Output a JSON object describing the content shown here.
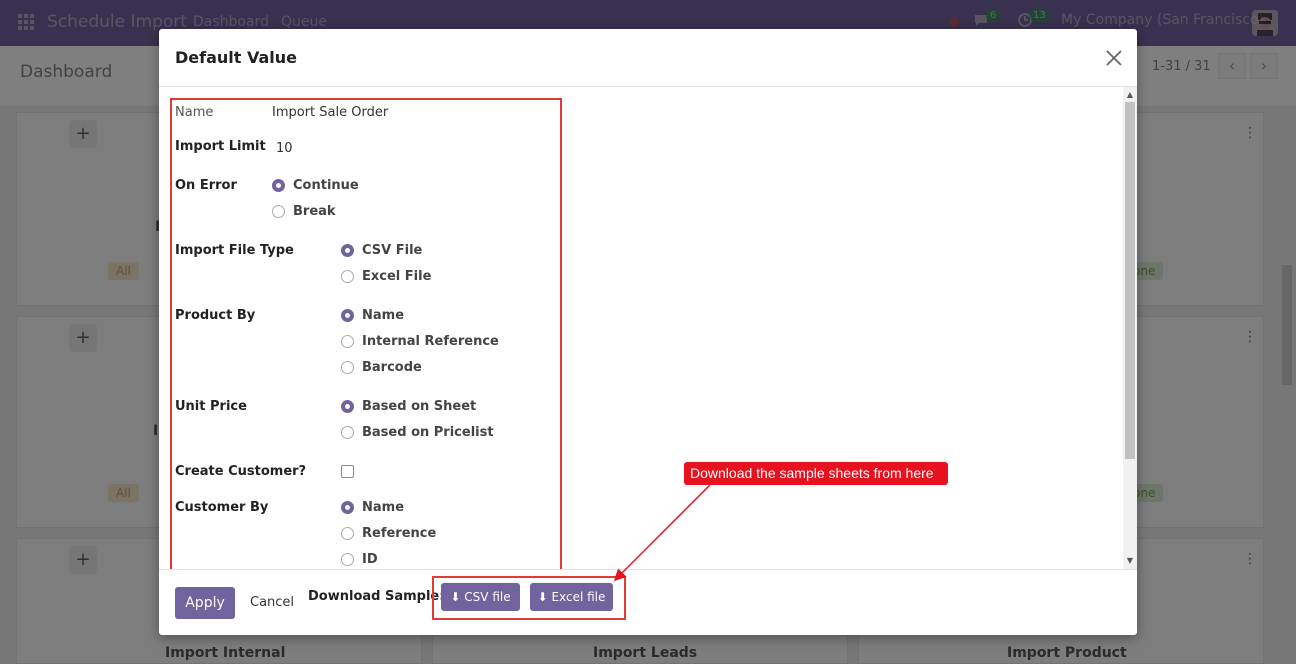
{
  "navbar": {
    "app_title": "Schedule Import",
    "menu": [
      "Dashboard",
      "Queue"
    ],
    "chat_count": "6",
    "activity_count": "13",
    "company": "My Company (San Francisco)"
  },
  "control_panel": {
    "breadcrumb": "Dashboard",
    "pager": "1-31 / 31"
  },
  "background": {
    "tag_all": "All",
    "tag_done": "one",
    "card_titles": [
      "Import Internal",
      "Import Leads",
      "Import Product"
    ],
    "partial_letters": [
      "I",
      "I"
    ]
  },
  "dialog": {
    "title": "Default Value",
    "fields": {
      "name_label": "Name",
      "name_value": "Import Sale Order",
      "import_limit_label": "Import Limit",
      "import_limit_value": "10",
      "on_error_label": "On Error",
      "on_error_options": [
        "Continue",
        "Break"
      ],
      "on_error_selected": "Continue",
      "file_type_label": "Import File Type",
      "file_type_options": [
        "CSV File",
        "Excel File"
      ],
      "file_type_selected": "CSV File",
      "product_by_label": "Product By",
      "product_by_options": [
        "Name",
        "Internal Reference",
        "Barcode"
      ],
      "product_by_selected": "Name",
      "unit_price_label": "Unit Price",
      "unit_price_options": [
        "Based on Sheet",
        "Based on Pricelist"
      ],
      "unit_price_selected": "Based on Sheet",
      "create_customer_label": "Create Customer?",
      "create_customer_checked": false,
      "customer_by_label": "Customer By",
      "customer_by_options": [
        "Name",
        "Reference",
        "ID"
      ],
      "customer_by_selected": "Name"
    },
    "footer": {
      "apply": "Apply",
      "cancel": "Cancel",
      "download_label": "Download Sample:",
      "csv_button": "CSV file",
      "excel_button": "Excel file"
    }
  },
  "annotation": {
    "text": "Download the sample sheets from here",
    "color": "#e8111f"
  },
  "colors": {
    "brand": "#71639e",
    "highlight": "#e53935"
  }
}
